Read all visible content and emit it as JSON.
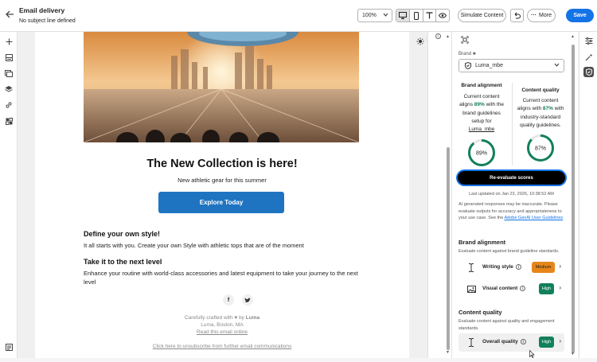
{
  "header": {
    "title": "Email delivery",
    "subtitle": "No subject line defined",
    "zoom": "100%",
    "simulate_label": "Simulate Content",
    "more_label": "More",
    "save_label": "Save"
  },
  "email": {
    "headline": "The New Collection is here!",
    "tagline": "New athletic gear for this summer",
    "cta": "Explore Today",
    "section1_title": "Define your own style!",
    "section1_text": "It all starts with you. Create your own Style with athletic tops that are of the moment",
    "section2_title": "Take it to the next level",
    "section2_text": "Enhance your routine with world-class accessories and latest equipment to take your journey to the next level",
    "footer_crafted": "Carefully crafted with ♥ by",
    "footer_brand": "Luma",
    "footer_location": "Luma, Boston, MA",
    "footer_online": "Read this email online",
    "unsubscribe": "Click here to unsubscribe from further email communications"
  },
  "panel": {
    "brand_label": "Brand",
    "brand_value": "Luma_mbe",
    "alignment_title": "Brand alignment",
    "alignment_text1": "Current content",
    "alignment_text2_pre": "aligns",
    "alignment_pct": "89%",
    "alignment_text2_post": "with the",
    "alignment_text3": "brand guidelines",
    "alignment_text4": "setup for",
    "alignment_link": "Luma_mbe",
    "alignment_ring": "89%",
    "alignment_value": 89,
    "quality_title": "Content quality",
    "quality_text1": "Current content",
    "quality_text2_pre": "aligns with",
    "quality_pct": "87%",
    "quality_text3": "industry-standard",
    "quality_text4": "quality guidelines.",
    "quality_ring": "87%",
    "quality_value": 87,
    "reevaluate": "Re-evaluate scores",
    "last_updated": "Last updated on Jan 23, 2026, 10:38:52 AM",
    "disclaimer1": "AI generated responses may be inaccurate. Please",
    "disclaimer2": "evaluate outputs for accuracy and appropriateness to",
    "disclaimer3": "your use case. See the",
    "disclaimer_link": "Adobe GenAI User Guidelines",
    "brand_section": "Brand alignment",
    "brand_section_desc": "Evaluate content against brand guideline standards.",
    "writing_style": "Writing style",
    "writing_badge": "Medium",
    "visual_content": "Visual content",
    "visual_badge": "High",
    "quality_section": "Content quality",
    "quality_section_desc1": "Evaluate content against quality and engagement",
    "quality_section_desc2": "standards.",
    "overall_quality": "Overall quality",
    "overall_badge": "High"
  },
  "colors": {
    "accent": "#1473e6",
    "cta": "#1f74c1",
    "high": "#12805c",
    "medium": "#e68619"
  }
}
